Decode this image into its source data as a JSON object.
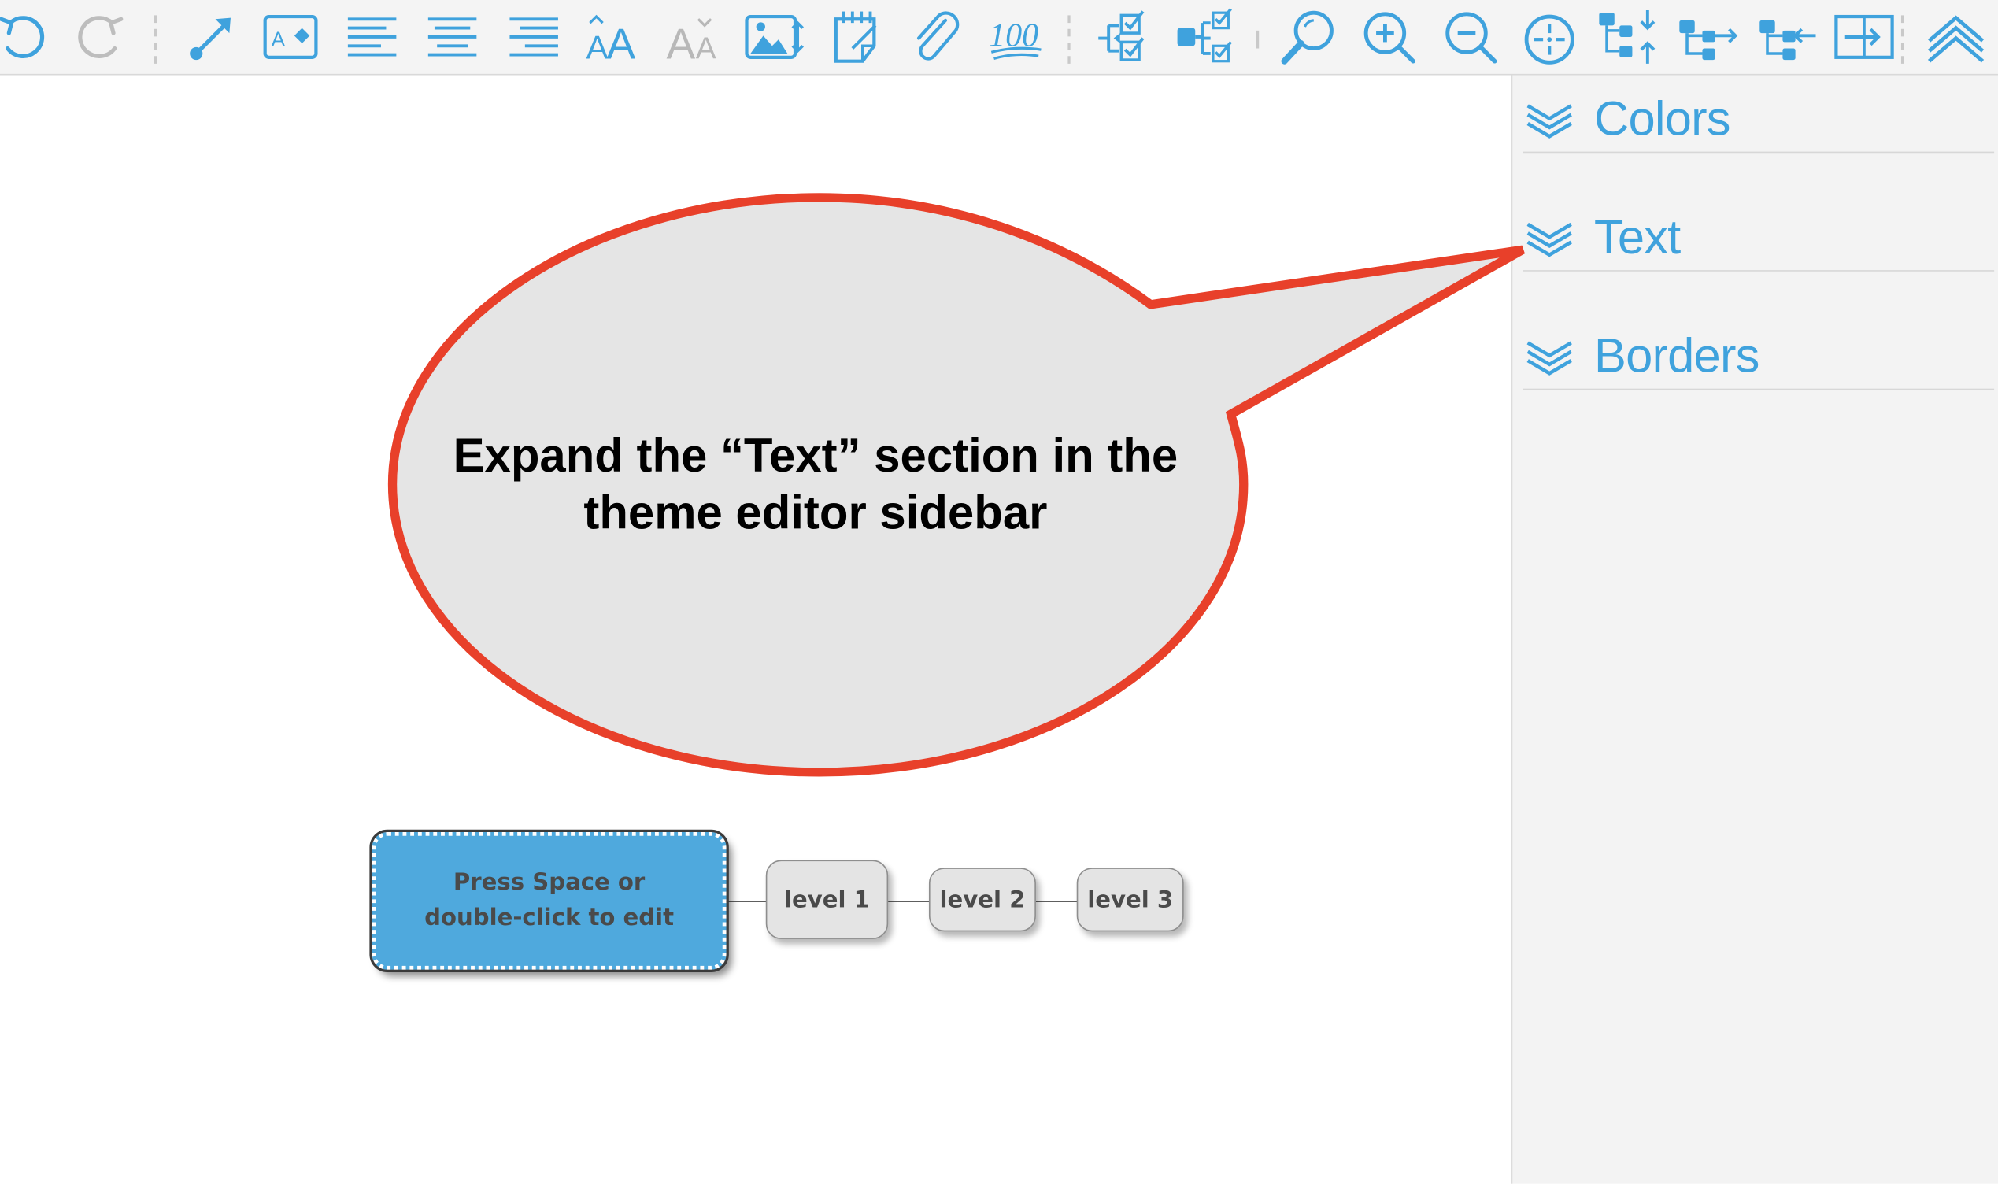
{
  "toolbar": {
    "buttons": [
      {
        "name": "undo-button",
        "icon": "undo-icon",
        "enabled": true
      },
      {
        "name": "redo-button",
        "icon": "redo-icon",
        "enabled": false
      },
      {
        "name": "connector-button",
        "icon": "arrow-connector-icon"
      },
      {
        "name": "text-style-button",
        "icon": "text-box-icon"
      },
      {
        "name": "align-left-button",
        "icon": "align-left-icon"
      },
      {
        "name": "align-center-button",
        "icon": "align-center-icon"
      },
      {
        "name": "align-right-button",
        "icon": "align-right-icon"
      },
      {
        "name": "increase-font-button",
        "icon": "font-size-increase-icon"
      },
      {
        "name": "decrease-font-button",
        "icon": "font-size-decrease-icon",
        "enabled": false
      },
      {
        "name": "insert-image-button",
        "icon": "image-icon"
      },
      {
        "name": "note-button",
        "icon": "notepad-icon"
      },
      {
        "name": "attachment-button",
        "icon": "paperclip-icon"
      },
      {
        "name": "progress-button",
        "icon": "hundred-icon"
      },
      {
        "name": "select-children-button",
        "icon": "select-children-icon"
      },
      {
        "name": "select-siblings-button",
        "icon": "select-siblings-icon"
      },
      {
        "name": "search-button",
        "icon": "search-icon"
      },
      {
        "name": "zoom-in-button",
        "icon": "zoom-in-icon"
      },
      {
        "name": "zoom-out-button",
        "icon": "zoom-out-icon"
      },
      {
        "name": "center-button",
        "icon": "crosshair-icon"
      },
      {
        "name": "layout-vertical-button",
        "icon": "tree-vertical-icon"
      },
      {
        "name": "layout-right-button",
        "icon": "tree-right-icon"
      },
      {
        "name": "layout-left-button",
        "icon": "tree-left-icon"
      },
      {
        "name": "frame-button",
        "icon": "frame-arrow-icon"
      },
      {
        "name": "collapse-toolbar-button",
        "icon": "double-chevron-up-icon"
      }
    ],
    "accent_color": "#3fa2dd",
    "disabled_color": "#b8b8b8"
  },
  "callout": {
    "text": "Expand the “Text” section in the theme editor sidebar",
    "fill_color": "#e5e5e5",
    "border_color": "#e8402a"
  },
  "mindmap": {
    "root": {
      "label": "Press Space or double-click to edit",
      "color": "#4fa9dd"
    },
    "children": [
      {
        "label": "level 1"
      },
      {
        "label": "level 2"
      },
      {
        "label": "level 3"
      }
    ],
    "node_color": "#e4e4e4"
  },
  "sidebar": {
    "sections": [
      {
        "label": "Colors",
        "icon": "double-chevron-down-icon"
      },
      {
        "label": "Text",
        "icon": "double-chevron-down-icon"
      },
      {
        "label": "Borders",
        "icon": "double-chevron-down-icon"
      }
    ],
    "accent_color": "#3fa2dd"
  }
}
